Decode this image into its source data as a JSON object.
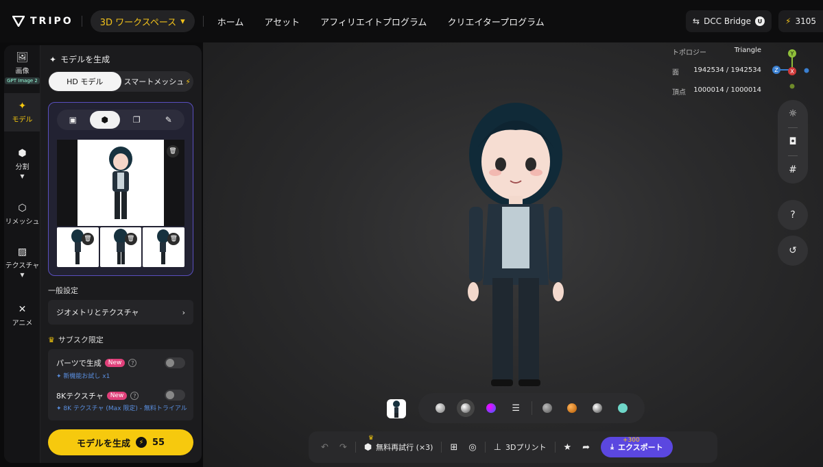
{
  "brand": {
    "name": "TRIPO"
  },
  "header": {
    "workspace_label": "3D ワークスペース",
    "nav": [
      "ホーム",
      "アセット",
      "アフィリエイトプログラム",
      "クリエイタープログラム"
    ],
    "dcc_bridge": "DCC Bridge",
    "credits": "3105"
  },
  "rail": {
    "image_label": "画像",
    "gpt_badge": "GPT Image 2",
    "model_label": "モデル",
    "split_label": "分割",
    "remesh_label": "リメッシュ",
    "texture_label": "テクスチャ",
    "anime_label": "アニメ"
  },
  "panel": {
    "title": "モデルを生成",
    "mode_hd": "HD モデル",
    "mode_smart": "スマートメッシュ",
    "general_settings": "一般設定",
    "geometry_texture": "ジオメトリとテクスチャ",
    "subscription_only": "サブスク限定",
    "parts_gen": "パーツで生成",
    "new_badge": "New",
    "parts_sub": "新機能お試し x1",
    "tex8k": "8Kテクスチャ",
    "tex8k_sub": "8K テクスチャ (Max 限定) - 無料トライアル",
    "generate_button": "モデルを生成",
    "generate_cost": "55"
  },
  "topology": {
    "label": "トポロジー",
    "value": "Triangle",
    "faces_label": "面",
    "faces_value": "1942534 / 1942534",
    "verts_label": "頂点",
    "verts_value": "1000014 / 1000014"
  },
  "gizmo": {
    "y": "Y",
    "z": "Z",
    "x": "X"
  },
  "bottom": {
    "retry": "無料再試行 (×3)",
    "print3d": "3Dプリント",
    "plus": "+300",
    "export": "エクスポート"
  },
  "colors": {
    "accent_yellow": "#f6c90e",
    "export_purple": "#5b47e0",
    "upload_border": "#5a4fc0"
  }
}
